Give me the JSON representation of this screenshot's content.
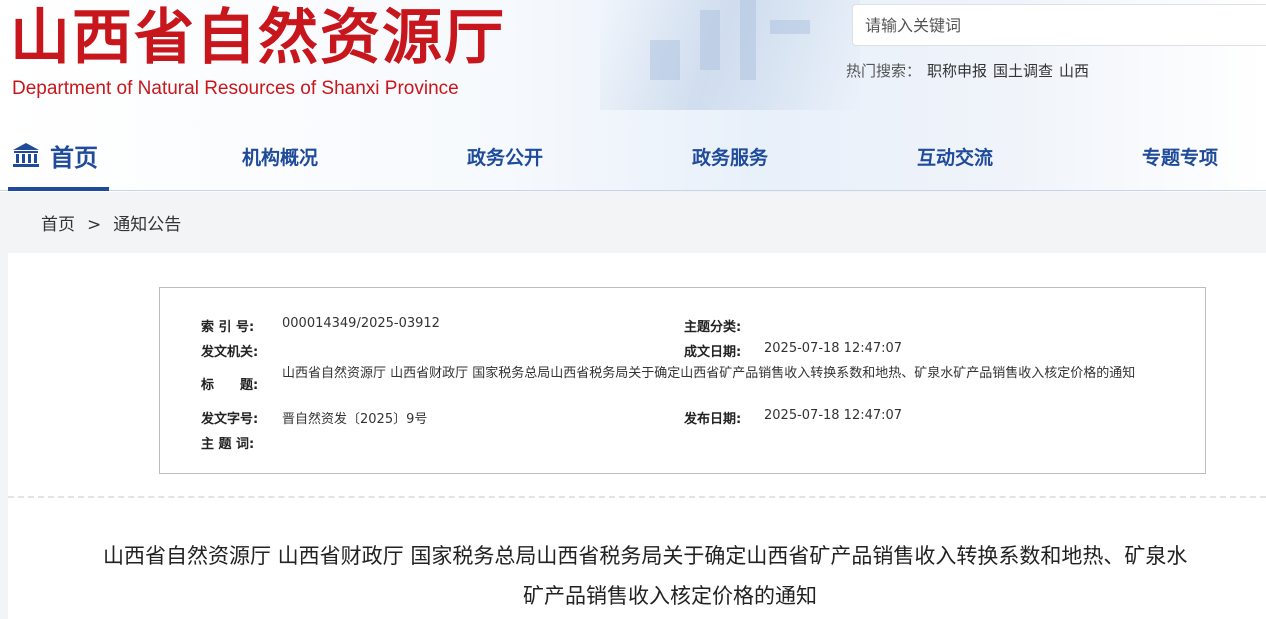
{
  "header": {
    "logo_cn": "山西省自然资源厅",
    "logo_en": "Department of Natural Resources of Shanxi Province",
    "search_placeholder": "请输入关键词",
    "hot_label": "热门搜索：",
    "hot_links": [
      "职称申报",
      "国土调查",
      "山西"
    ]
  },
  "nav": {
    "home": "首页",
    "items": [
      "机构概况",
      "政务公开",
      "政务服务",
      "互动交流",
      "专题专项"
    ]
  },
  "breadcrumb": {
    "home": "首页",
    "separator": ">",
    "current": "通知公告"
  },
  "meta": {
    "index_label": "索 引 号:",
    "index_value": "000014349/2025-03912",
    "topic_label": "主题分类:",
    "topic_value": "",
    "issuer_label": "发文机关:",
    "issuer_value": "",
    "created_label": "成文日期:",
    "created_value": "2025-07-18 12:47:07",
    "title_label": "标　　题:",
    "title_value": "山西省自然资源厅 山西省财政厅 国家税务总局山西省税务局关于确定山西省矿产品销售收入转换系数和地热、矿泉水矿产品销售收入核定价格的通知",
    "doc_no_label": "发文字号:",
    "doc_no_value": "晋自然资发〔2025〕9号",
    "published_label": "发布日期:",
    "published_value": "2025-07-18 12:47:07",
    "keywords_label": "主 题 词:",
    "keywords_value": ""
  },
  "doc": {
    "title_line1": "山西省自然资源厅 山西省财政厅 国家税务总局山西省税务局关于确定山西省矿产品销售收入转换系数和地热、矿泉水",
    "title_line2": "矿产品销售收入核定价格的通知"
  },
  "colors": {
    "brand_red": "#c8161d",
    "nav_blue": "#1f4b9a"
  }
}
